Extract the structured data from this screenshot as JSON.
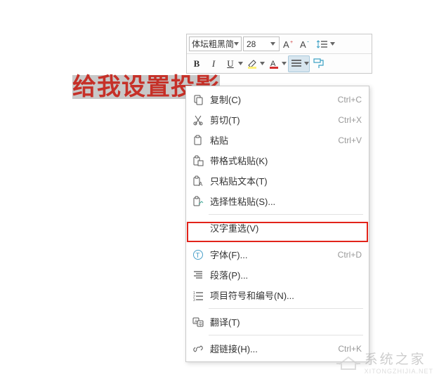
{
  "toolbar": {
    "font_name": "体坛粗黑简",
    "font_size": "28"
  },
  "selection_text": "给我设置投影",
  "context_menu": {
    "items": [
      {
        "icon": "copy-icon",
        "label": "复制(C)",
        "shortcut": "Ctrl+C"
      },
      {
        "icon": "cut-icon",
        "label": "剪切(T)",
        "shortcut": "Ctrl+X"
      },
      {
        "icon": "paste-icon",
        "label": "粘贴",
        "shortcut": "Ctrl+V"
      },
      {
        "icon": "paste-format-icon",
        "label": "带格式粘贴(K)",
        "shortcut": ""
      },
      {
        "icon": "paste-text-icon",
        "label": "只粘贴文本(T)",
        "shortcut": ""
      },
      {
        "icon": "paste-special-icon",
        "label": "选择性粘贴(S)...",
        "shortcut": ""
      },
      {
        "sep": true
      },
      {
        "icon": "",
        "label": "汉字重选(V)",
        "shortcut": ""
      },
      {
        "sep": true
      },
      {
        "icon": "font-icon",
        "label": "字体(F)...",
        "shortcut": "Ctrl+D"
      },
      {
        "icon": "paragraph-icon",
        "label": "段落(P)...",
        "shortcut": ""
      },
      {
        "icon": "numbering-icon",
        "label": "项目符号和编号(N)...",
        "shortcut": ""
      },
      {
        "sep": true
      },
      {
        "icon": "translate-icon",
        "label": "翻译(T)",
        "shortcut": ""
      },
      {
        "sep": true
      },
      {
        "icon": "hyperlink-icon",
        "label": "超链接(H)...",
        "shortcut": "Ctrl+K"
      }
    ]
  },
  "watermark": {
    "text": "系统之家",
    "url": "XITONGZHIJIA.NET"
  }
}
